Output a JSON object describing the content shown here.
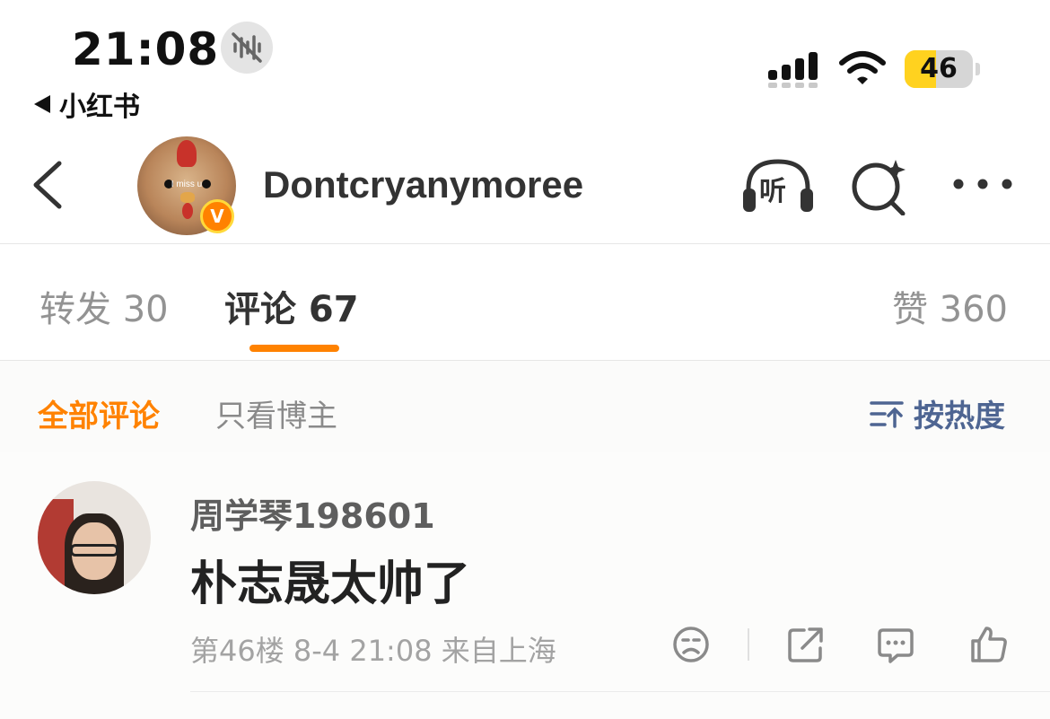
{
  "status_bar": {
    "time": "21:08",
    "back_app": "小红书",
    "battery_level": "46",
    "battery_fraction": 0.46
  },
  "header": {
    "username": "Dontcryanymoree",
    "avatar_caption": "I miss u",
    "verified_mark": "V",
    "listen_label": "听"
  },
  "tabs": [
    {
      "label": "转发 30"
    },
    {
      "label": "评论 67"
    },
    {
      "label": "赞 360"
    }
  ],
  "filter": {
    "all": "全部评论",
    "owner_only": "只看博主",
    "sort": "按热度"
  },
  "comment": {
    "author": "周学琴198601",
    "text": "朴志晟太帅了",
    "meta": "第46楼 8-4 21:08 来自上海"
  },
  "colors": {
    "accent": "#ff8200",
    "sort_blue": "#4e6592",
    "muted": "#939393"
  },
  "icons": [
    "mute-icon",
    "signal-icon",
    "wifi-icon",
    "back-icon",
    "headphones-icon",
    "search-spark-icon",
    "more-icon",
    "sort-icon",
    "dislike-icon",
    "share-icon",
    "reply-icon",
    "like-icon"
  ]
}
